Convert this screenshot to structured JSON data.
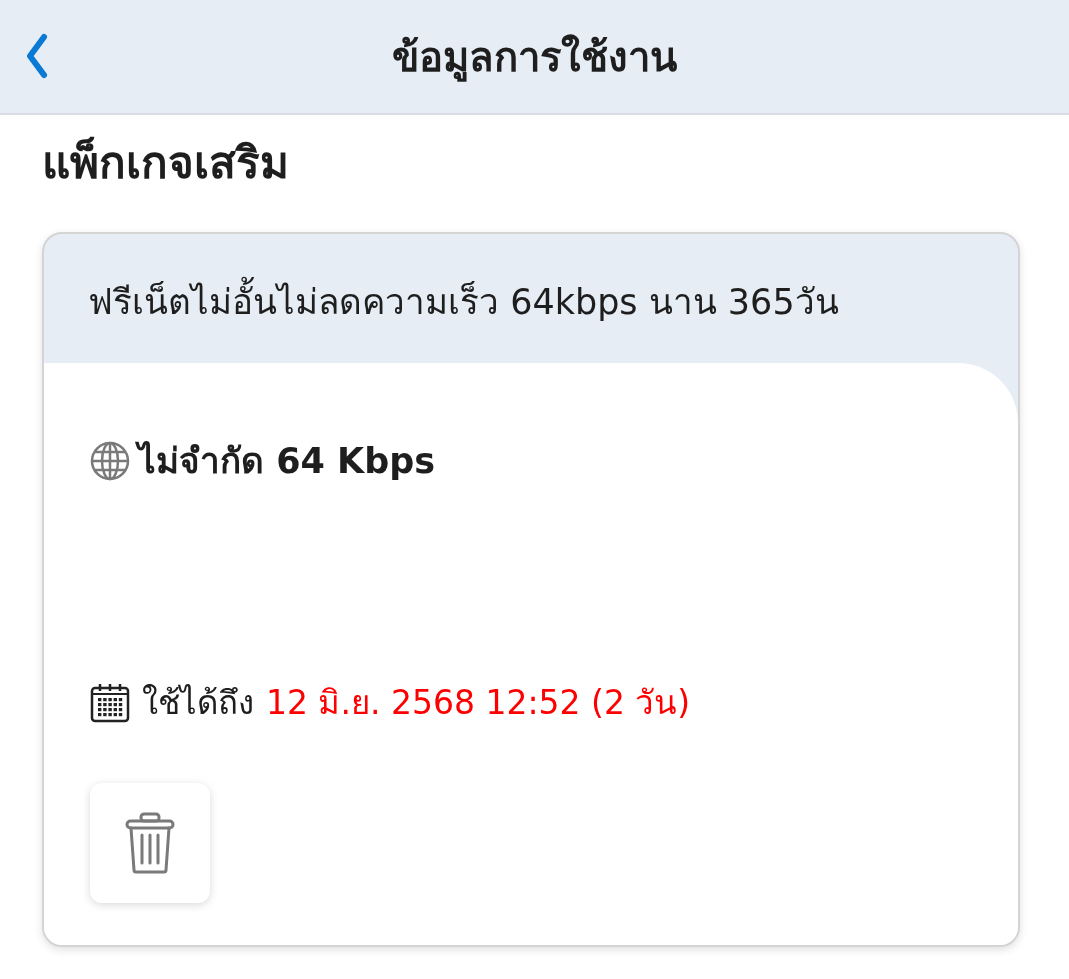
{
  "header": {
    "title": "ข้อมูลการใช้งาน"
  },
  "section_title": "แพ็กเกจเสริม",
  "packages": [
    {
      "name": "ฟรีเน็ตไม่อั้นไม่ลดความเร็ว 64kbps นาน 365วัน",
      "quota": "ไม่จำกัด 64 Kbps",
      "expiry_label": "ใช้ได้ถึง",
      "expiry_value": "12 มิ.ย. 2568 12:52 (2 วัน)",
      "expiring_soon": true
    }
  ]
}
